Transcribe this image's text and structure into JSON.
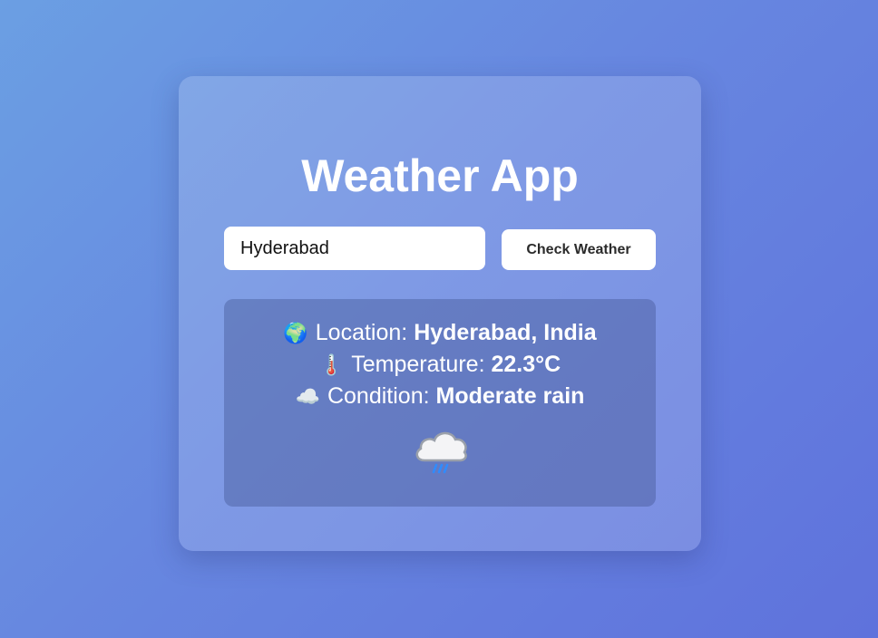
{
  "app": {
    "title": "Weather App"
  },
  "search": {
    "value": "Hyderabad",
    "button_label": "Check Weather"
  },
  "result": {
    "location": {
      "icon": "globe-icon",
      "label": "Location:",
      "value": "Hyderabad, India"
    },
    "temperature": {
      "icon": "thermometer-icon",
      "label": "Temperature:",
      "value": "22.3°C"
    },
    "condition": {
      "icon": "cloud-icon",
      "label": "Condition:",
      "value": "Moderate rain"
    },
    "weather_icon": "rain-cloud-icon"
  },
  "colors": {
    "background_start": "#6b9fe3",
    "background_end": "#5f72dc",
    "text": "#ffffff",
    "rain": "#2f8cff"
  }
}
